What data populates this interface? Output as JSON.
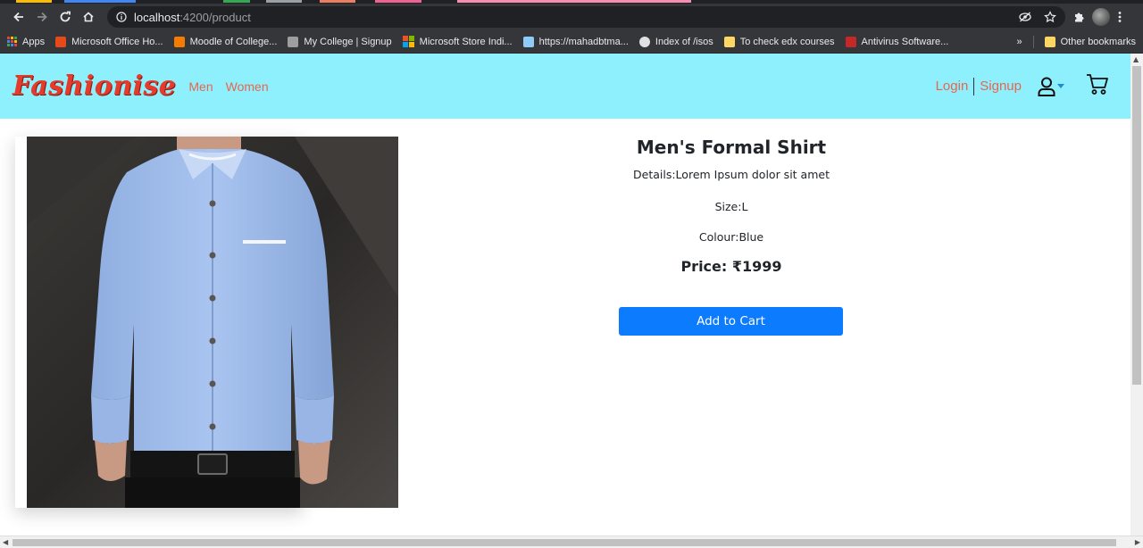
{
  "browser": {
    "url_host": "localhost",
    "url_path": ":4200/product",
    "bookmarks": [
      {
        "label": "Apps",
        "color": "#4285f4"
      },
      {
        "label": "Microsoft Office Ho...",
        "color": "#e64a19"
      },
      {
        "label": "Moodle of College...",
        "color": "#f57c00"
      },
      {
        "label": "My College | Signup",
        "color": "#9e9e9e"
      },
      {
        "label": "Microsoft Store Indi...",
        "color": "#7cbb00"
      },
      {
        "label": "https://mahadbtma...",
        "color": "#90caf9"
      },
      {
        "label": "Index of /isos",
        "color": "#e0e0e0"
      },
      {
        "label": "To check edx courses",
        "color": "#fdd663"
      },
      {
        "label": "Antivirus Software...",
        "color": "#c62828"
      }
    ],
    "more_bookmarks": "»",
    "other_bookmarks": "Other bookmarks"
  },
  "navbar": {
    "brand": "Fashionise",
    "links": [
      "Men",
      "Women"
    ],
    "login": "Login",
    "signup": "Signup"
  },
  "product": {
    "title": "Men's Formal Shirt",
    "details": "Details:Lorem Ipsum dolor sit amet",
    "size": "Size:L",
    "colour": "Colour:Blue",
    "price": "Price: ₹1999",
    "add_to_cart": "Add to Cart"
  },
  "colors": {
    "navbar_bg": "#8ef0fc",
    "brand": "#e53b2c",
    "link": "#e8664f",
    "button": "#0d7bfe"
  }
}
